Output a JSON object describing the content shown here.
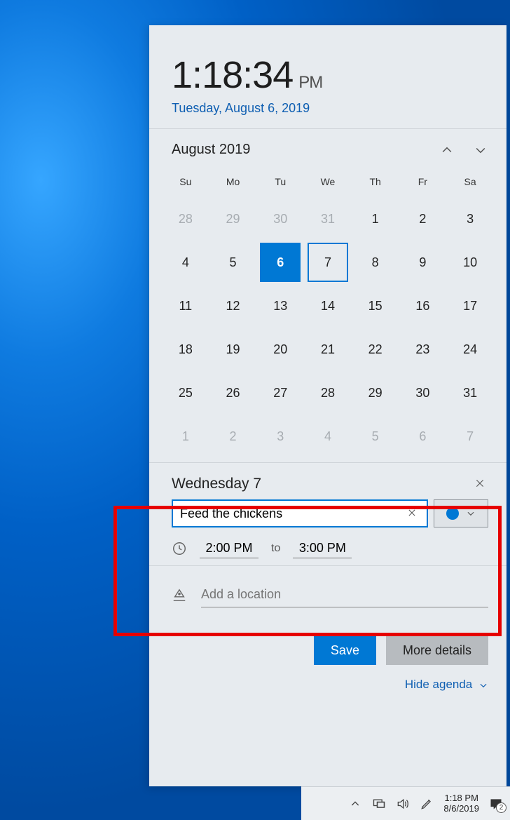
{
  "clock": {
    "hours": "1",
    "minutes": "18",
    "seconds": "34",
    "ampm": "PM",
    "date": "Tuesday, August 6, 2019"
  },
  "calendar": {
    "month_label": "August 2019",
    "day_headers": [
      "Su",
      "Mo",
      "Tu",
      "We",
      "Th",
      "Fr",
      "Sa"
    ],
    "weeks": [
      [
        {
          "n": "28",
          "muted": true
        },
        {
          "n": "29",
          "muted": true
        },
        {
          "n": "30",
          "muted": true
        },
        {
          "n": "31",
          "muted": true
        },
        {
          "n": "1"
        },
        {
          "n": "2"
        },
        {
          "n": "3"
        }
      ],
      [
        {
          "n": "4"
        },
        {
          "n": "5"
        },
        {
          "n": "6",
          "today": true
        },
        {
          "n": "7",
          "selected": true
        },
        {
          "n": "8"
        },
        {
          "n": "9"
        },
        {
          "n": "10"
        }
      ],
      [
        {
          "n": "11"
        },
        {
          "n": "12"
        },
        {
          "n": "13"
        },
        {
          "n": "14"
        },
        {
          "n": "15"
        },
        {
          "n": "16"
        },
        {
          "n": "17"
        }
      ],
      [
        {
          "n": "18"
        },
        {
          "n": "19"
        },
        {
          "n": "20"
        },
        {
          "n": "21"
        },
        {
          "n": "22"
        },
        {
          "n": "23"
        },
        {
          "n": "24"
        }
      ],
      [
        {
          "n": "25"
        },
        {
          "n": "26"
        },
        {
          "n": "27"
        },
        {
          "n": "28"
        },
        {
          "n": "29"
        },
        {
          "n": "30"
        },
        {
          "n": "31"
        }
      ],
      [
        {
          "n": "1",
          "muted": true
        },
        {
          "n": "2",
          "muted": true
        },
        {
          "n": "3",
          "muted": true
        },
        {
          "n": "4",
          "muted": true
        },
        {
          "n": "5",
          "muted": true
        },
        {
          "n": "6",
          "muted": true
        },
        {
          "n": "7",
          "muted": true
        }
      ]
    ]
  },
  "agenda": {
    "day_title": "Wednesday 7",
    "event_title": "Feed the chickens",
    "start_time": "2:00 PM",
    "to_label": "to",
    "end_time": "3:00 PM",
    "location_placeholder": "Add a location",
    "save_label": "Save",
    "details_label": "More details",
    "hide_label": "Hide agenda"
  },
  "taskbar": {
    "time": "1:18 PM",
    "date": "8/6/2019",
    "badge_count": "2"
  }
}
